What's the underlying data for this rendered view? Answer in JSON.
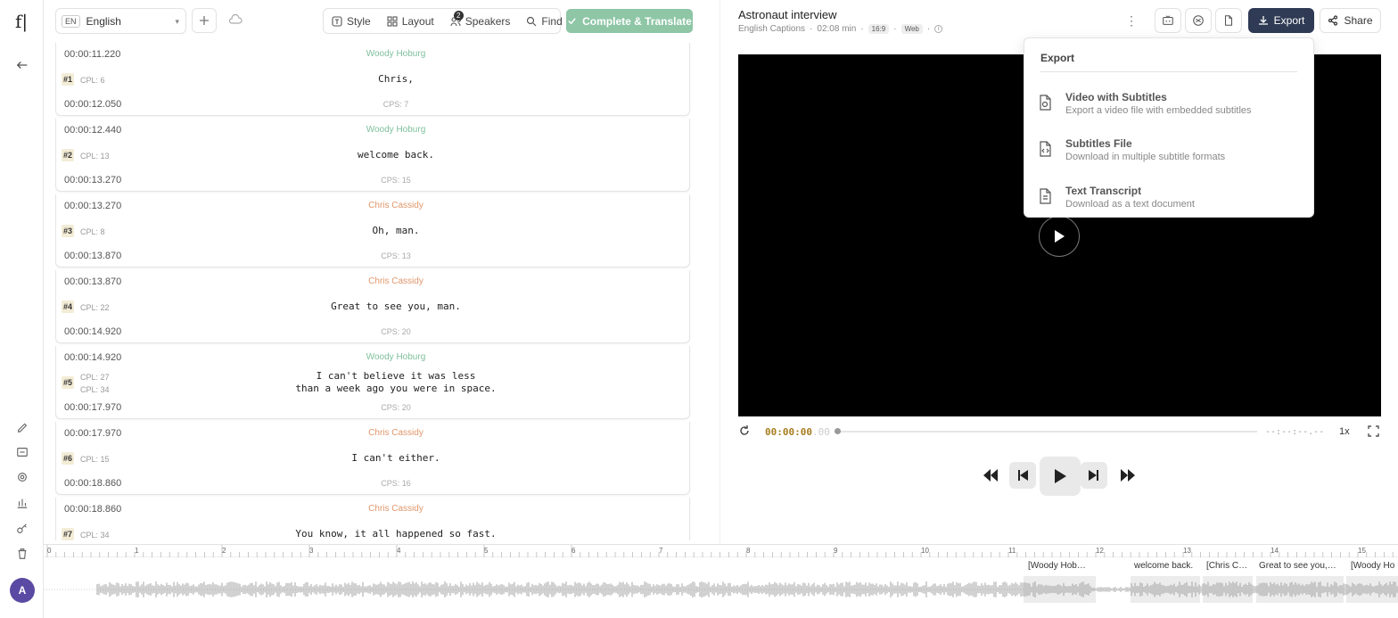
{
  "app": {
    "logo": "f|"
  },
  "toolbar": {
    "language_code": "EN",
    "language": "English",
    "style": "Style",
    "layout": "Layout",
    "speakers": "Speakers",
    "speakers_count": "2",
    "find": "Find",
    "complete": "Complete & Translate"
  },
  "project": {
    "title": "Astronaut interview",
    "captions": "English Captions",
    "duration": "02:08 min",
    "aspect": "16:9",
    "platform": "Web",
    "export_label": "Export",
    "share_label": "Share"
  },
  "subtitles": [
    {
      "num": "#1",
      "start": "00:00:11.220",
      "end": "00:00:12.050",
      "speaker": "Woody Hoburg",
      "color": "green",
      "cpl": [
        "CPL: 6"
      ],
      "cps": "CPS: 7",
      "lines": [
        "Chris,"
      ]
    },
    {
      "num": "#2",
      "start": "00:00:12.440",
      "end": "00:00:13.270",
      "speaker": "Woody Hoburg",
      "color": "green",
      "cpl": [
        "CPL: 13"
      ],
      "cps": "CPS: 15",
      "lines": [
        "welcome back."
      ]
    },
    {
      "num": "#3",
      "start": "00:00:13.270",
      "end": "00:00:13.870",
      "speaker": "Chris Cassidy",
      "color": "orange",
      "cpl": [
        "CPL: 8"
      ],
      "cps": "CPS: 13",
      "lines": [
        "Oh, man."
      ]
    },
    {
      "num": "#4",
      "start": "00:00:13.870",
      "end": "00:00:14.920",
      "speaker": "Chris Cassidy",
      "color": "orange",
      "cpl": [
        "CPL: 22"
      ],
      "cps": "CPS: 20",
      "lines": [
        "Great to see you, man."
      ]
    },
    {
      "num": "#5",
      "start": "00:00:14.920",
      "end": "00:00:17.970",
      "speaker": "Woody Hoburg",
      "color": "green",
      "cpl": [
        "CPL: 27",
        "CPL: 34"
      ],
      "cps": "CPS: 20",
      "lines": [
        "I can't believe it was less",
        "than a week ago you were in space."
      ]
    },
    {
      "num": "#6",
      "start": "00:00:17.970",
      "end": "00:00:18.860",
      "speaker": "Chris Cassidy",
      "color": "orange",
      "cpl": [
        "CPL: 15"
      ],
      "cps": "CPS: 16",
      "lines": [
        "I can't either."
      ]
    },
    {
      "num": "#7",
      "start": "00:00:18.860",
      "end": "",
      "speaker": "Chris Cassidy",
      "color": "orange",
      "cpl": [
        "CPL: 34"
      ],
      "cps": "",
      "lines": [
        "You know, it all happened so fast."
      ]
    }
  ],
  "player": {
    "timecode_main": "00:00:00",
    "timecode_frac": ".00",
    "duration": "--:--:--.--",
    "speed": "1x"
  },
  "export_menu": {
    "title": "Export",
    "items": [
      {
        "label": "Video with Subtitles",
        "desc": "Export a video file with embedded subtitles",
        "icon": "video-file-icon"
      },
      {
        "label": "Subtitles File",
        "desc": "Download in multiple subtitle formats",
        "icon": "code-file-icon"
      },
      {
        "label": "Text Transcript",
        "desc": "Download as a text document",
        "icon": "text-file-icon"
      }
    ]
  },
  "timeline": {
    "ticks": [
      "0",
      "1",
      "2",
      "3",
      "4",
      "5",
      "6",
      "7",
      "8",
      "9",
      "10",
      "11",
      "12",
      "13",
      "14",
      "15"
    ],
    "captions": [
      "[Woody Hob…",
      "welcome back.",
      "[Chris C…",
      "Great to see you,…",
      "[Woody Ho"
    ]
  },
  "colors": {
    "green": "#7fbf9c",
    "orange": "#e0976b",
    "accent": "#2f3a54"
  }
}
